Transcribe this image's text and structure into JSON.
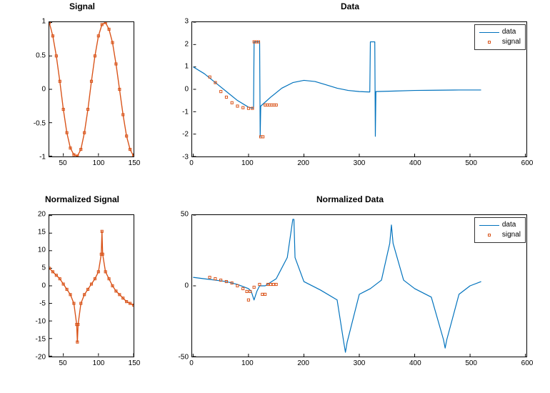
{
  "colors": {
    "data_line": "#0072BD",
    "signal": "#D95319"
  },
  "chart_data": [
    {
      "id": "signal",
      "type": "line",
      "title": "Signal",
      "xlim": [
        30,
        150
      ],
      "ylim": [
        -1,
        1
      ],
      "xticks": [
        50,
        100,
        150
      ],
      "yticks": [
        -1,
        -0.5,
        0,
        0.5,
        1
      ],
      "series": [
        {
          "name": "signal",
          "style": "line+markers",
          "color": "#D95319",
          "x": [
            30,
            35,
            40,
            45,
            50,
            55,
            60,
            65,
            70,
            75,
            80,
            85,
            90,
            95,
            100,
            105,
            110,
            115,
            120,
            125,
            130,
            135,
            140,
            145,
            150
          ],
          "y": [
            1.0,
            0.8,
            0.5,
            0.12,
            -0.3,
            -0.65,
            -0.88,
            -0.98,
            -1.0,
            -0.9,
            -0.65,
            -0.3,
            0.12,
            0.5,
            0.8,
            0.97,
            1.0,
            0.9,
            0.7,
            0.38,
            0.0,
            -0.38,
            -0.7,
            -0.9,
            -1.0
          ]
        }
      ]
    },
    {
      "id": "data",
      "type": "line",
      "title": "Data",
      "xlim": [
        0,
        600
      ],
      "ylim": [
        -3,
        3
      ],
      "xticks": [
        0,
        100,
        200,
        300,
        400,
        500,
        600
      ],
      "yticks": [
        -3,
        -2,
        -1,
        0,
        1,
        2,
        3
      ],
      "legend": {
        "position": "top-right",
        "items": [
          {
            "label": "data",
            "style": "line",
            "color": "#0072BD"
          },
          {
            "label": "signal",
            "style": "marker",
            "color": "#D95319"
          }
        ]
      },
      "series": [
        {
          "name": "data",
          "style": "line",
          "color": "#0072BD",
          "x": [
            0,
            20,
            40,
            60,
            80,
            100,
            109,
            110,
            120,
            121,
            122,
            140,
            160,
            180,
            200,
            220,
            240,
            260,
            280,
            300,
            319,
            320,
            328,
            329,
            330,
            360,
            400,
            440,
            480,
            520
          ],
          "y": [
            1.0,
            0.7,
            0.3,
            -0.1,
            -0.5,
            -0.8,
            -0.85,
            2.12,
            2.12,
            -2.12,
            -0.75,
            -0.35,
            0.05,
            0.3,
            0.4,
            0.35,
            0.2,
            0.05,
            -0.05,
            -0.1,
            -0.12,
            2.12,
            2.12,
            -2.1,
            -0.1,
            -0.08,
            -0.05,
            -0.04,
            -0.03,
            -0.03
          ]
        },
        {
          "name": "signal",
          "style": "markers",
          "color": "#D95319",
          "x": [
            30,
            40,
            50,
            60,
            70,
            80,
            90,
            100,
            107,
            110,
            114,
            118,
            122,
            126,
            130,
            134,
            138,
            142,
            146,
            150
          ],
          "y": [
            0.55,
            0.3,
            -0.1,
            -0.35,
            -0.6,
            -0.75,
            -0.82,
            -0.85,
            -0.85,
            2.12,
            2.12,
            2.12,
            -2.12,
            -2.12,
            -0.7,
            -0.7,
            -0.7,
            -0.7,
            -0.7,
            -0.7
          ]
        }
      ]
    },
    {
      "id": "norm_signal",
      "type": "line",
      "title": "Normalized Signal",
      "xlim": [
        30,
        150
      ],
      "ylim": [
        -20,
        20
      ],
      "xticks": [
        50,
        100,
        150
      ],
      "yticks": [
        -20,
        -15,
        -10,
        -5,
        0,
        5,
        10,
        15,
        20
      ],
      "series": [
        {
          "name": "signal",
          "style": "line+markers",
          "color": "#D95319",
          "x": [
            30,
            35,
            40,
            45,
            50,
            55,
            60,
            65,
            69,
            70,
            71,
            75,
            80,
            85,
            90,
            95,
            100,
            104,
            105,
            106,
            110,
            115,
            120,
            125,
            130,
            135,
            140,
            145,
            150
          ],
          "y": [
            5.0,
            4.0,
            3.0,
            2.0,
            0.5,
            -1.0,
            -2.5,
            -5.0,
            -11.0,
            -16.0,
            -11.0,
            -5.0,
            -2.5,
            -1.0,
            0.5,
            2.0,
            4.0,
            9.0,
            15.5,
            9.0,
            4.0,
            2.0,
            0.0,
            -1.5,
            -2.5,
            -3.5,
            -4.5,
            -5.0,
            -5.5
          ]
        }
      ]
    },
    {
      "id": "norm_data",
      "type": "line",
      "title": "Normalized Data",
      "xlim": [
        0,
        600
      ],
      "ylim": [
        -50,
        50
      ],
      "xticks": [
        0,
        100,
        200,
        300,
        400,
        500,
        600
      ],
      "yticks": [
        -50,
        0,
        50
      ],
      "legend": {
        "position": "top-right",
        "items": [
          {
            "label": "data",
            "style": "line",
            "color": "#0072BD"
          },
          {
            "label": "signal",
            "style": "marker",
            "color": "#D95319"
          }
        ]
      },
      "series": [
        {
          "name": "data",
          "style": "line",
          "color": "#0072BD",
          "x": [
            0,
            20,
            40,
            60,
            80,
            100,
            105,
            110,
            115,
            120,
            130,
            150,
            170,
            180,
            182,
            184,
            200,
            230,
            260,
            272,
            275,
            278,
            300,
            320,
            340,
            355,
            358,
            361,
            380,
            400,
            430,
            452,
            455,
            458,
            480,
            500,
            520
          ],
          "y": [
            6,
            5,
            4,
            3,
            1,
            -2,
            -4,
            -10,
            -4,
            0,
            0,
            5,
            20,
            47,
            47,
            20,
            3,
            -3,
            -10,
            -40,
            -47,
            -40,
            -6,
            -2,
            4,
            30,
            43,
            30,
            4,
            -2,
            -8,
            -38,
            -44,
            -38,
            -6,
            0,
            3
          ]
        },
        {
          "name": "signal",
          "style": "markers",
          "color": "#D95319",
          "x": [
            30,
            40,
            50,
            60,
            70,
            80,
            90,
            97,
            100,
            103,
            110,
            120,
            125,
            130,
            135,
            140,
            145,
            150
          ],
          "y": [
            6,
            5,
            4,
            3,
            2,
            0,
            -2,
            -4,
            -10,
            -4,
            -1,
            1,
            -6,
            -6,
            1,
            1,
            1,
            1
          ]
        }
      ]
    }
  ]
}
